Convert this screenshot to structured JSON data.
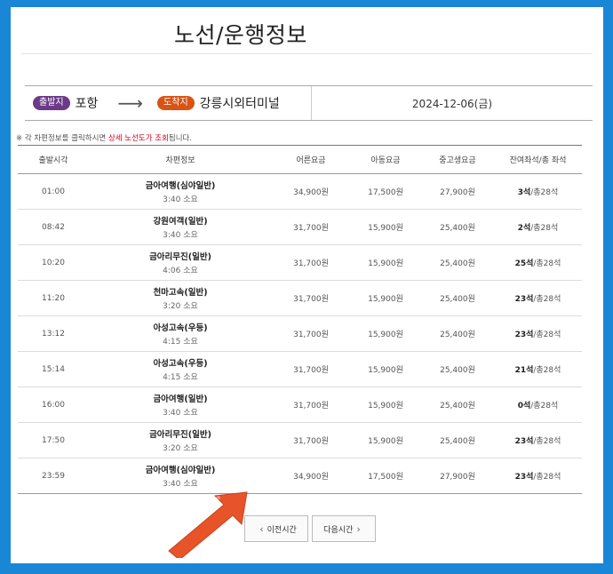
{
  "page": {
    "title": "노선/운행정보"
  },
  "route": {
    "departure_badge": "출발지",
    "departure": "포항",
    "arrow": "⟶",
    "arrival_badge": "도착지",
    "arrival": "강릉시외터미널",
    "date": "2024-12-06(금)"
  },
  "notice": {
    "prefix": "※ 각 차편정보를 클릭하시면 ",
    "highlight1": "상세 노선도가",
    "middle": " ",
    "highlight2": "조회",
    "suffix": "됩니다."
  },
  "table": {
    "headers": [
      "출발시각",
      "차편정보",
      "어른요금",
      "아동요금",
      "중고생요금",
      "잔여좌석/총 좌석"
    ],
    "rows": [
      {
        "time": "01:00",
        "bus": "금아여행(심야일반)",
        "duration": "3:40 소요",
        "adult": "34,900원",
        "child": "17,500원",
        "student": "27,900원",
        "seats": "3석",
        "total": "/총28석"
      },
      {
        "time": "08:42",
        "bus": "강원여객(일반)",
        "duration": "3:40 소요",
        "adult": "31,700원",
        "child": "15,900원",
        "student": "25,400원",
        "seats": "2석",
        "total": "/총28석"
      },
      {
        "time": "10:20",
        "bus": "금아리무진(일반)",
        "duration": "4:06 소요",
        "adult": "31,700원",
        "child": "15,900원",
        "student": "25,400원",
        "seats": "25석",
        "total": "/총28석"
      },
      {
        "time": "11:20",
        "bus": "천마고속(일반)",
        "duration": "3:20 소요",
        "adult": "31,700원",
        "child": "15,900원",
        "student": "25,400원",
        "seats": "23석",
        "total": "/총28석"
      },
      {
        "time": "13:12",
        "bus": "아성고속(우등)",
        "duration": "4:15 소요",
        "adult": "31,700원",
        "child": "15,900원",
        "student": "25,400원",
        "seats": "23석",
        "total": "/총28석"
      },
      {
        "time": "15:14",
        "bus": "아성고속(우등)",
        "duration": "4:15 소요",
        "adult": "31,700원",
        "child": "15,900원",
        "student": "25,400원",
        "seats": "21석",
        "total": "/총28석"
      },
      {
        "time": "16:00",
        "bus": "금아여행(일반)",
        "duration": "3:40 소요",
        "adult": "31,700원",
        "child": "15,900원",
        "student": "25,400원",
        "seats": "0석",
        "total": "/총28석"
      },
      {
        "time": "17:50",
        "bus": "금아리무진(일반)",
        "duration": "3:20 소요",
        "adult": "31,700원",
        "child": "15,900원",
        "student": "25,400원",
        "seats": "23석",
        "total": "/총28석"
      },
      {
        "time": "23:59",
        "bus": "금아여행(심야일반)",
        "duration": "3:40 소요",
        "adult": "34,900원",
        "child": "17,500원",
        "student": "27,900원",
        "seats": "23석",
        "total": "/총28석"
      }
    ]
  },
  "pagination": {
    "prev_label": "이전시간",
    "next_label": "다음시간",
    "prev_icon": "chevron-left-icon",
    "next_icon": "chevron-right-icon"
  },
  "colors": {
    "frame": "#1a86d6",
    "departure_badge": "#6b3a88",
    "arrival_badge": "#d85314",
    "notice_highlight": "#d0021b",
    "pointer_arrow": "#e8542a"
  }
}
